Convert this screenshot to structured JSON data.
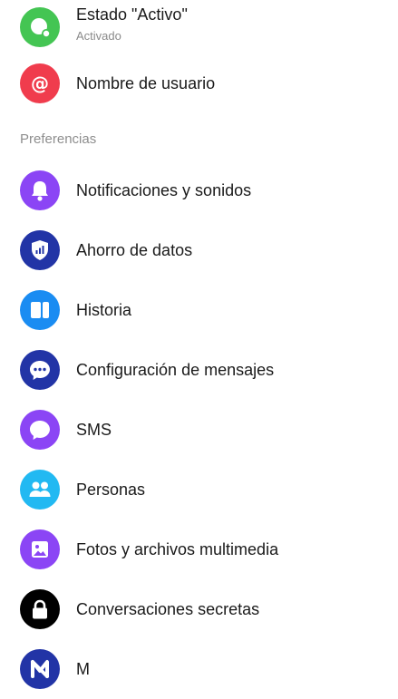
{
  "account_items": [
    {
      "label": "Estado \"Activo\"",
      "sublabel": "Activado",
      "icon": "active-status-icon",
      "color": "#44c553"
    },
    {
      "label": "Nombre de usuario",
      "icon": "at-sign-icon",
      "color": "#f03c4d"
    }
  ],
  "preferences": {
    "header": "Preferencias",
    "items": [
      {
        "label": "Notificaciones y sonidos",
        "icon": "bell-icon",
        "color": "#8b45f5"
      },
      {
        "label": "Ahorro de datos",
        "icon": "shield-signal-icon",
        "color": "#2234a6"
      },
      {
        "label": "Historia",
        "icon": "story-icon",
        "color": "#1a8cf2"
      },
      {
        "label": "Configuración de mensajes",
        "icon": "chat-bubble-dots-icon",
        "color": "#2234a6"
      },
      {
        "label": "SMS",
        "icon": "sms-bubble-icon",
        "color": "#8b45f5"
      },
      {
        "label": "Personas",
        "icon": "people-icon",
        "color": "#22b9f2"
      },
      {
        "label": "Fotos y archivos multimedia",
        "icon": "photo-icon",
        "color": "#8b45f5"
      },
      {
        "label": "Conversaciones secretas",
        "icon": "lock-icon",
        "color": "#000000"
      },
      {
        "label": "M",
        "icon": "m-assistant-icon",
        "color": "#2234a6"
      }
    ]
  }
}
